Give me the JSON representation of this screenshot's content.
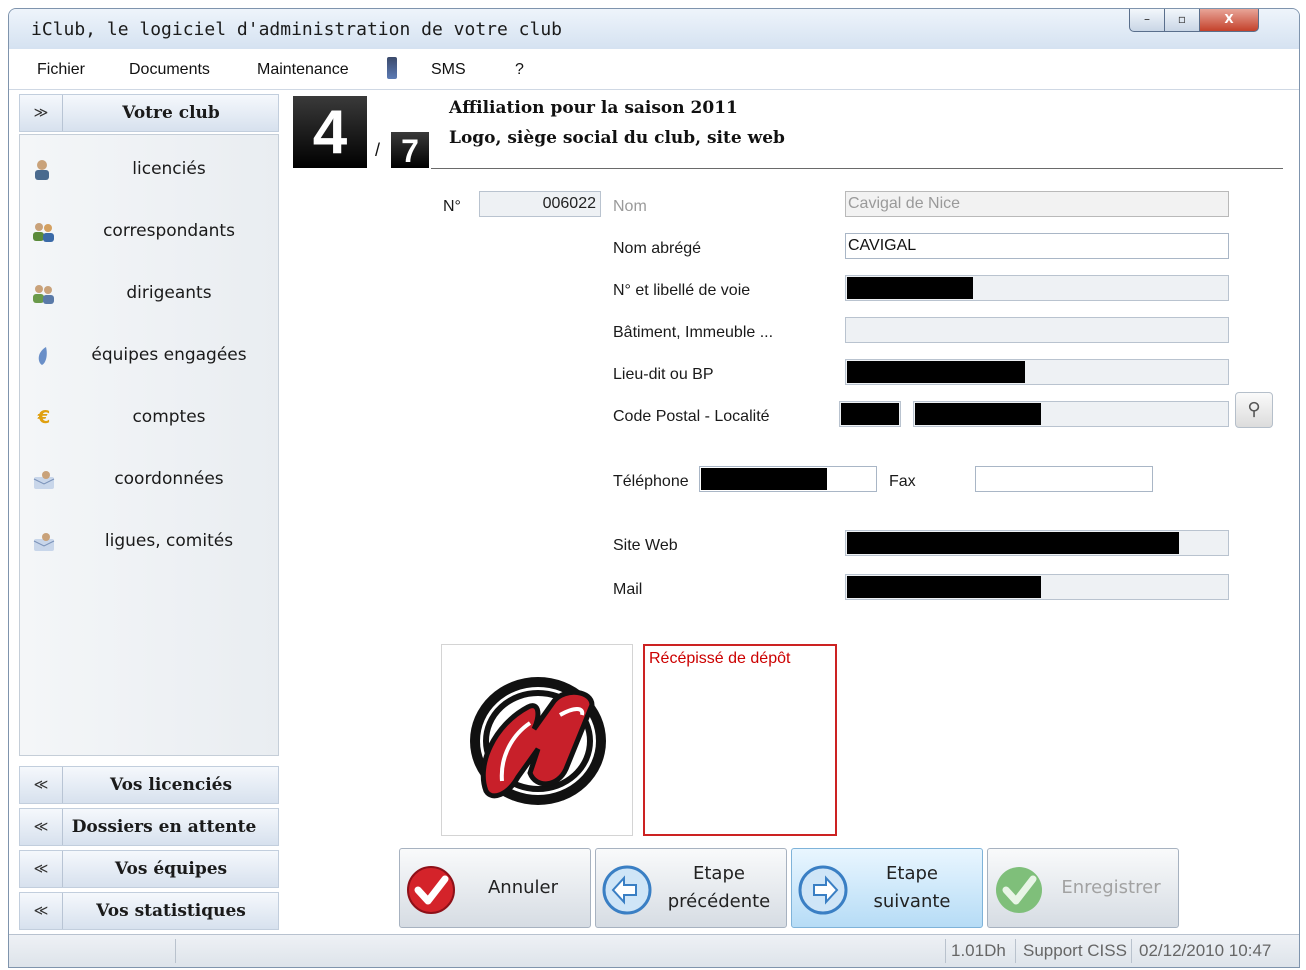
{
  "window": {
    "title": "iClub, le logiciel d'administration de votre club",
    "controls": [
      "–",
      "▫",
      "X"
    ]
  },
  "menu": [
    "Fichier",
    "Documents",
    "Maintenance",
    "SMS",
    "?"
  ],
  "sidebar": {
    "top_panel": "Votre club",
    "items": [
      {
        "label": "licenciés",
        "icon": "person-icon"
      },
      {
        "label": "correspondants",
        "icon": "people-icon"
      },
      {
        "label": "dirigeants",
        "icon": "leaders-icon"
      },
      {
        "label": "équipes engagées",
        "icon": "team-icon"
      },
      {
        "label": "comptes",
        "icon": "euro-icon"
      },
      {
        "label": "coordonnées",
        "icon": "address-card-icon"
      },
      {
        "label": "ligues, comités",
        "icon": "address-card-icon"
      }
    ],
    "bottom_panels": [
      "Vos licenciés",
      "Dossiers en attente",
      "Vos équipes",
      "Vos statistiques"
    ]
  },
  "step": {
    "current": "4",
    "separator": "/",
    "total": "7"
  },
  "heading": {
    "line1": "Affiliation pour la saison 2011",
    "line2": "Logo, siège social du club, site web"
  },
  "form": {
    "numero_label": "N°",
    "numero_value": "006022",
    "nom_label": "Nom",
    "nom_value": "Cavigal de Nice",
    "nom_abrege_label": "Nom abrégé",
    "nom_abrege_value": "CAVIGAL",
    "voie_label": "N° et libellé de voie",
    "batiment_label": "Bâtiment, Immeuble ...",
    "lieu_dit_label": "Lieu-dit ou BP",
    "code_postal_label": "Code Postal - Localité",
    "telephone_label": "Téléphone",
    "fax_label": "Fax",
    "site_web_label": "Site Web",
    "mail_label": "Mail"
  },
  "recepisse_label": "Récépissé de dépôt",
  "buttons": {
    "annuler": "Annuler",
    "precedente_line1": "Etape",
    "precedente_line2": "précédente",
    "suivante": "Etape suivante",
    "enregistrer": "Enregistrer"
  },
  "status": {
    "duration": "1.01Dh",
    "support": "Support CISS",
    "datetime": "02/12/2010 10:47"
  },
  "colors": {
    "accent_red": "#cc2222",
    "window_frame": "#7f94ad"
  }
}
